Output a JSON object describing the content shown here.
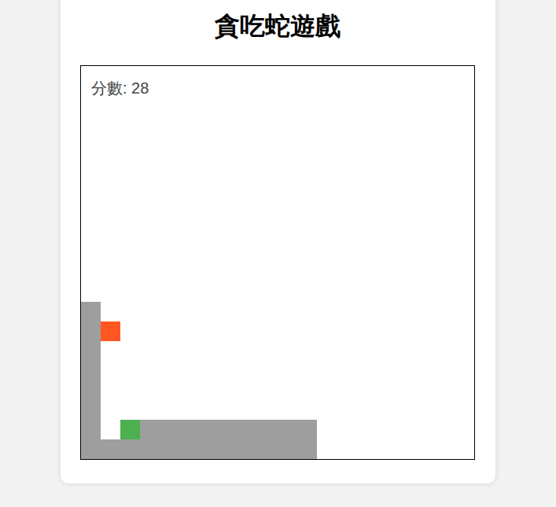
{
  "title": "貪吃蛇遊戲",
  "score": "分數: 28",
  "food": {
    "col": 1,
    "row": 13,
    "color": "#ff5722"
  },
  "snake": [
    {
      "col": 2,
      "row": 18,
      "kind": "head"
    },
    {
      "col": 3,
      "row": 18,
      "kind": "body"
    },
    {
      "col": 4,
      "row": 18,
      "kind": "body"
    },
    {
      "col": 5,
      "row": 18,
      "kind": "body"
    },
    {
      "col": 6,
      "row": 18,
      "kind": "body"
    },
    {
      "col": 7,
      "row": 18,
      "kind": "body"
    },
    {
      "col": 8,
      "row": 18,
      "kind": "body"
    },
    {
      "col": 9,
      "row": 18,
      "kind": "body"
    },
    {
      "col": 10,
      "row": 18,
      "kind": "body"
    },
    {
      "col": 11,
      "row": 18,
      "kind": "body"
    },
    {
      "col": 11,
      "row": 19,
      "kind": "body"
    },
    {
      "col": 10,
      "row": 19,
      "kind": "body"
    },
    {
      "col": 9,
      "row": 19,
      "kind": "body"
    },
    {
      "col": 8,
      "row": 19,
      "kind": "body"
    },
    {
      "col": 7,
      "row": 19,
      "kind": "body"
    },
    {
      "col": 6,
      "row": 19,
      "kind": "body"
    },
    {
      "col": 5,
      "row": 19,
      "kind": "body"
    },
    {
      "col": 4,
      "row": 19,
      "kind": "body"
    },
    {
      "col": 3,
      "row": 19,
      "kind": "body"
    },
    {
      "col": 2,
      "row": 19,
      "kind": "body"
    },
    {
      "col": 1,
      "row": 19,
      "kind": "body"
    },
    {
      "col": 0,
      "row": 19,
      "kind": "body"
    },
    {
      "col": 0,
      "row": 18,
      "kind": "body"
    },
    {
      "col": 0,
      "row": 17,
      "kind": "body"
    },
    {
      "col": 0,
      "row": 16,
      "kind": "body"
    },
    {
      "col": 0,
      "row": 15,
      "kind": "body"
    },
    {
      "col": 0,
      "row": 14,
      "kind": "body"
    },
    {
      "col": 0,
      "row": 13,
      "kind": "body"
    },
    {
      "col": 0,
      "row": 12,
      "kind": "body"
    }
  ]
}
